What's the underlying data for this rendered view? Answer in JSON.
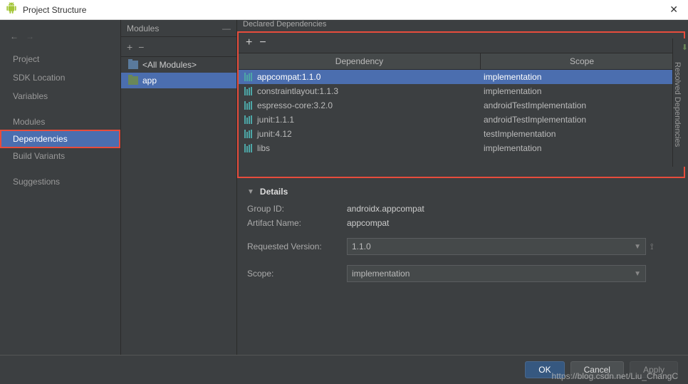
{
  "window": {
    "title": "Project Structure"
  },
  "sidebar": {
    "items": [
      {
        "label": "Project"
      },
      {
        "label": "SDK Location"
      },
      {
        "label": "Variables"
      },
      {
        "label": "Modules"
      },
      {
        "label": "Dependencies"
      },
      {
        "label": "Build Variants"
      },
      {
        "label": "Suggestions"
      }
    ]
  },
  "modules": {
    "header": "Modules",
    "items": [
      {
        "label": "<All Modules>"
      },
      {
        "label": "app"
      }
    ]
  },
  "deps": {
    "header": "Declared Dependencies",
    "columns": {
      "dep": "Dependency",
      "scope": "Scope"
    },
    "rows": [
      {
        "name": "appcompat:1.1.0",
        "scope": "implementation"
      },
      {
        "name": "constraintlayout:1.1.3",
        "scope": "implementation"
      },
      {
        "name": "espresso-core:3.2.0",
        "scope": "androidTestImplementation"
      },
      {
        "name": "junit:1.1.1",
        "scope": "androidTestImplementation"
      },
      {
        "name": "junit:4.12",
        "scope": "testImplementation"
      },
      {
        "name": "libs",
        "scope": "implementation"
      }
    ]
  },
  "details": {
    "title": "Details",
    "group_id_label": "Group ID:",
    "group_id": "androidx.appcompat",
    "artifact_label": "Artifact Name:",
    "artifact": "appcompat",
    "version_label": "Requested Version:",
    "version": "1.1.0",
    "scope_label": "Scope:",
    "scope": "implementation"
  },
  "rightTab": "Resolved Dependencies",
  "buttons": {
    "ok": "OK",
    "cancel": "Cancel",
    "apply": "Apply"
  },
  "watermark": "https://blog.csdn.net/Liu_ChangC"
}
